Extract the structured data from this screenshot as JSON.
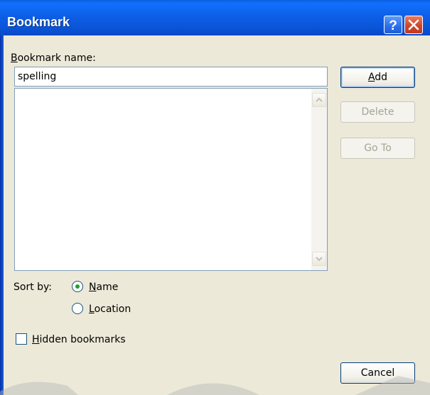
{
  "dialog": {
    "title": "Bookmark"
  },
  "titlebar": {
    "help_icon": "question-mark-icon",
    "close_icon": "x-close-icon"
  },
  "bookmark_name": {
    "label_underlined": "B",
    "label_rest": "ookmark name:",
    "value": "spelling"
  },
  "buttons": {
    "add_underlined": "A",
    "add_rest": "dd",
    "delete": "Delete",
    "goto": "Go To",
    "cancel": "Cancel"
  },
  "sort": {
    "label": "Sort by:",
    "name_underlined": "N",
    "name_rest": "ame",
    "location_underlined": "L",
    "location_rest": "ocation",
    "selected": "Name"
  },
  "hidden": {
    "label_underlined": "H",
    "label_rest": "idden bookmarks",
    "checked": false
  }
}
